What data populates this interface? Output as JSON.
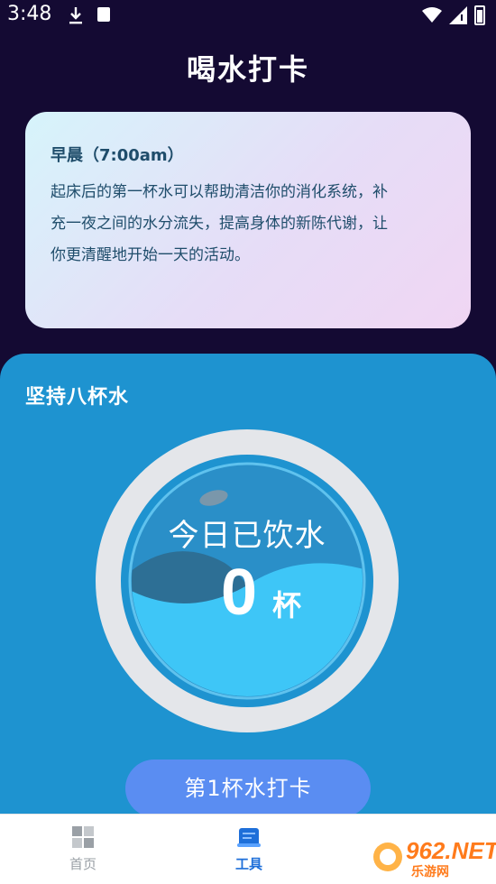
{
  "status_bar": {
    "time": "3:48"
  },
  "page": {
    "title": "喝水打卡"
  },
  "tip_card": {
    "title": "早晨（7:00am）",
    "lines": [
      "起床后的第一杯水可以帮助清洁你的消化系统，补",
      "充一夜之间的水分流失，提高身体的新陈代谢，让",
      "你更清醒地开始一天的活动。"
    ]
  },
  "panel": {
    "title": "坚持八杯水",
    "gauge_label": "今日已饮水",
    "cups_count": "0",
    "cups_unit": "杯",
    "checkin_label": "第1杯水打卡"
  },
  "bottom_nav": {
    "items": [
      {
        "label": "首页",
        "icon": "home-grid-icon",
        "active": false
      },
      {
        "label": "工具",
        "icon": "tools-icon",
        "active": true
      }
    ]
  },
  "watermark": {
    "brand": "962.NET",
    "sub": "乐游网"
  },
  "colors": {
    "background": "#140a33",
    "panel": "#1e93d0",
    "button": "#5a8df2",
    "water": "#3ec6f7",
    "ring": "#e4e6ea",
    "nav_active": "#1e6fd9"
  }
}
